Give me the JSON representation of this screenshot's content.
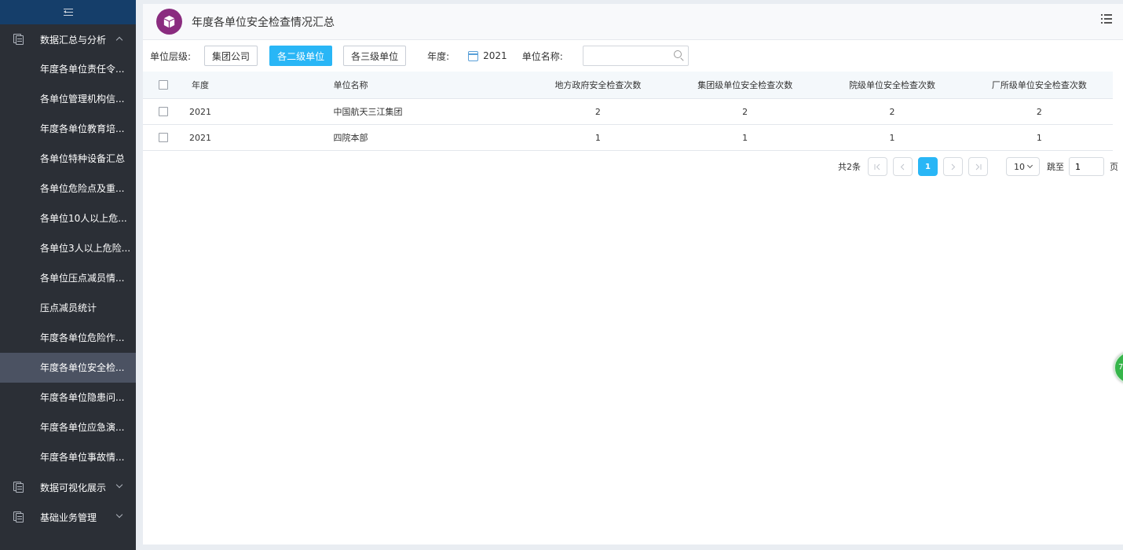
{
  "sidebar": {
    "groups": [
      {
        "label": "数据汇总与分析",
        "expanded": true,
        "icon": "document-icon"
      },
      {
        "label": "数据可视化展示",
        "expanded": false,
        "icon": "document-icon"
      },
      {
        "label": "基础业务管理",
        "expanded": false,
        "icon": "document-icon"
      }
    ],
    "items": [
      "年度各单位责任令...",
      "各单位管理机构信...",
      "年度各单位教育培...",
      "各单位特种设备汇总",
      "各单位危险点及重...",
      "各单位10人以上危...",
      "各单位3人以上危险...",
      "各单位压点减员情...",
      "压点减员统计",
      "年度各单位危险作...",
      "年度各单位安全检...",
      "年度各单位隐患问...",
      "年度各单位应急演...",
      "年度各单位事故情..."
    ],
    "active_index": 10
  },
  "header": {
    "title": "年度各单位安全检查情况汇总",
    "logo_color": "#8a2c7f"
  },
  "filters": {
    "level_label": "单位层级:",
    "levels": [
      "集团公司",
      "各二级单位",
      "各三级单位"
    ],
    "active_level": 1,
    "year_label": "年度:",
    "year_value": "2021",
    "name_label": "单位名称:",
    "name_value": "",
    "accent_color": "#29b6f6"
  },
  "table": {
    "columns": [
      "年度",
      "单位名称",
      "地方政府安全检查次数",
      "集团级单位安全检查次数",
      "院级单位安全检查次数",
      "厂所级单位安全检查次数"
    ],
    "rows": [
      {
        "year": "2021",
        "name": "中国航天三江集团",
        "n1": "2",
        "n2": "2",
        "n3": "2",
        "n4": "2"
      },
      {
        "year": "2021",
        "name": "四院本部",
        "n1": "1",
        "n2": "1",
        "n3": "1",
        "n4": "1"
      }
    ]
  },
  "pagination": {
    "total": "共2条",
    "current_page": "1",
    "page_size": "10",
    "jump_label": "跳至",
    "jump_value": "1",
    "page_unit": "页"
  },
  "float_bubble": {
    "text": "7"
  }
}
